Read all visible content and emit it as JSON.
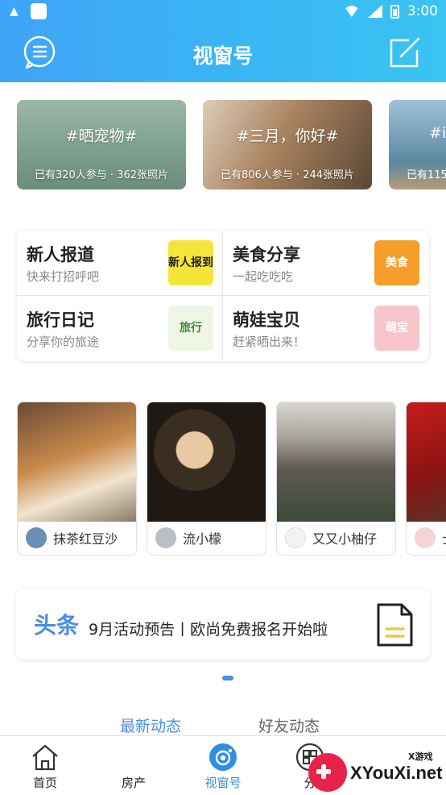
{
  "status_bar": {
    "time": "3:00"
  },
  "header": {
    "title": "视窗号"
  },
  "topics": [
    {
      "tag": "#晒宠物#",
      "stat": "已有320人参与 · 362张照片"
    },
    {
      "tag": "#三月，你好#",
      "stat": "已有806人参与 · 244张照片"
    },
    {
      "tag": "#i",
      "stat": "已有115"
    }
  ],
  "categories": [
    {
      "name": "新人报道",
      "sub": "快来打招呼吧",
      "thumb": "新人报到"
    },
    {
      "name": "美食分享",
      "sub": "一起吃吃吃",
      "thumb": "美食"
    },
    {
      "name": "旅行日记",
      "sub": "分享你的旅途",
      "thumb": "旅行"
    },
    {
      "name": "萌娃宝贝",
      "sub": "赶紧晒出来！",
      "thumb": "萌宝"
    }
  ],
  "photos": [
    {
      "user": "抹茶红豆沙"
    },
    {
      "user": "流小檬"
    },
    {
      "user": "又又小柚仔"
    },
    {
      "user": "士"
    }
  ],
  "headline": {
    "label": "头条",
    "text": "9月活动预告丨欧尚免费报名开始啦"
  },
  "feed_tabs": [
    "最新动态",
    "好友动态"
  ],
  "bottom_nav": [
    "首页",
    "房产",
    "视窗号",
    "分"
  ],
  "watermark": {
    "site": "XYouXi.net",
    "small": "X游戏"
  },
  "colors": {
    "header_start": "#3fa4f7",
    "header_end": "#39c4f2",
    "accent": "#4a8ee6",
    "active_nav": "#2e8fe0"
  }
}
